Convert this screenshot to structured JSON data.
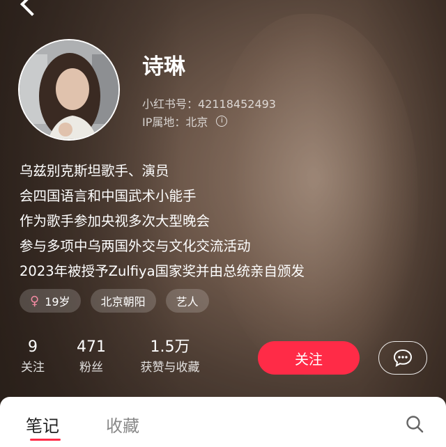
{
  "profile": {
    "name": "诗琳",
    "id_line": "小红书号：42118452493",
    "ip_line": "IP属地：北京"
  },
  "bio": [
    "乌兹别克斯坦歌手、演员",
    "会四国语言和中国武术小能手",
    "作为歌手参加央视多次大型晚会",
    "参与多项中乌两国外交与文化交流活动",
    "2023年被授予Zulfiya国家奖并由总统亲自颁发"
  ],
  "tags": [
    {
      "icon": "female-icon",
      "label": "19岁"
    },
    {
      "label": "北京朝阳"
    },
    {
      "label": "艺人"
    }
  ],
  "stats": [
    {
      "value": "9",
      "label": "关注"
    },
    {
      "value": "471",
      "label": "粉丝"
    },
    {
      "value": "1.5万",
      "label": "获赞与收藏"
    }
  ],
  "actions": {
    "follow_label": "关注",
    "message_icon": "chat-bubble-icon"
  },
  "tabs": [
    {
      "label": "笔记",
      "active": true
    },
    {
      "label": "收藏",
      "active": false
    }
  ],
  "colors": {
    "accent": "#ff2b47",
    "female": "#f28aa2"
  }
}
